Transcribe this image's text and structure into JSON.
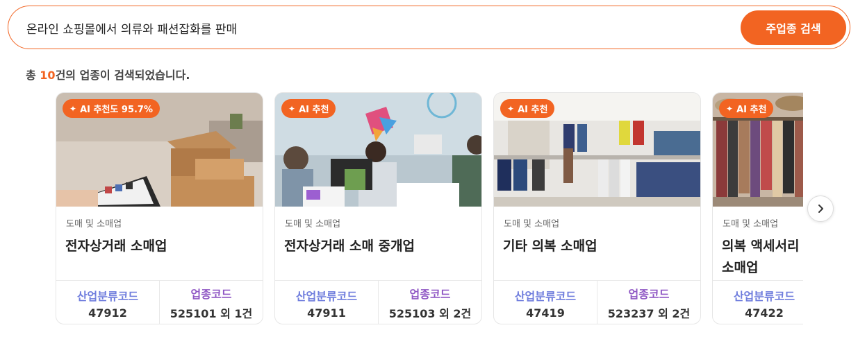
{
  "search": {
    "value": "온라인 쇼핑몰에서 의류와 패션잡화를 판매",
    "button_label": "주업종 검색"
  },
  "summary": {
    "prefix": "총 ",
    "count": "10",
    "suffix": "건의 업종이 검색되었습니다."
  },
  "labels": {
    "industry_code": "산업분류코드",
    "business_code": "업종코드"
  },
  "cards": [
    {
      "badge": "AI 추천도 95.7%",
      "category": "도매 및 소매업",
      "title": "전자상거래 소매업",
      "industry_code": "47912",
      "business_code": "525101 외 1건"
    },
    {
      "badge": "AI 추천",
      "category": "도매 및 소매업",
      "title": "전자상거래 소매 중개업",
      "industry_code": "47911",
      "business_code": "525103 외 2건"
    },
    {
      "badge": "AI 추천",
      "category": "도매 및 소매업",
      "title": "기타 의복 소매업",
      "industry_code": "47419",
      "business_code": "523237 외 2건"
    },
    {
      "badge": "AI 추천",
      "category": "도매 및 소매업",
      "title": "의복 액세서리 소매업",
      "industry_code": "47422",
      "business_code": ""
    }
  ],
  "icons": {
    "badge": "sparkle-icon",
    "next": "chevron-right-icon"
  },
  "colors": {
    "accent": "#f26422",
    "industry_code_label": "#6f7ddd",
    "business_code_label": "#8f57c4"
  }
}
